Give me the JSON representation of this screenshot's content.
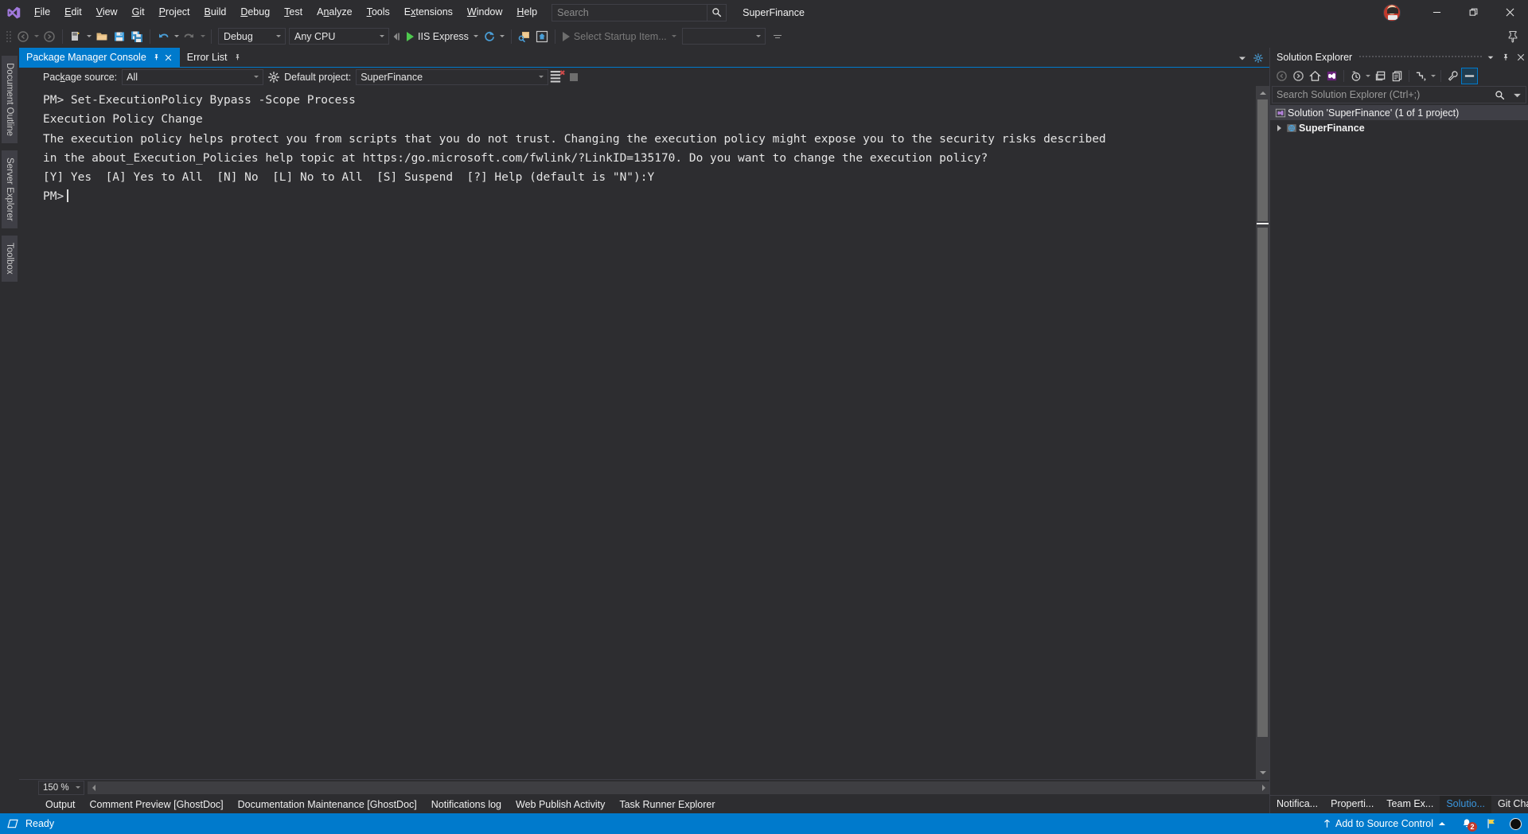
{
  "titlebar": {
    "logo_icon": "visual-studio-logo",
    "menus": [
      {
        "label": "File",
        "accel": "F"
      },
      {
        "label": "Edit",
        "accel": "E"
      },
      {
        "label": "View",
        "accel": "V"
      },
      {
        "label": "Git",
        "accel": "G"
      },
      {
        "label": "Project",
        "accel": "P"
      },
      {
        "label": "Build",
        "accel": "B"
      },
      {
        "label": "Debug",
        "accel": "D"
      },
      {
        "label": "Test",
        "accel": "T"
      },
      {
        "label": "Analyze",
        "accel": "n"
      },
      {
        "label": "Tools",
        "accel": "T"
      },
      {
        "label": "Extensions",
        "accel": "x"
      },
      {
        "label": "Window",
        "accel": "W"
      },
      {
        "label": "Help",
        "accel": "H"
      }
    ],
    "search_placeholder": "Search",
    "search_value": "",
    "solution_name": "SuperFinance",
    "window_buttons": [
      "minimize",
      "restore",
      "close"
    ]
  },
  "toolbar": {
    "nav_back_icon": "navigate-back-icon",
    "nav_forward_icon": "navigate-forward-icon",
    "new_project_icon": "new-project-icon",
    "open_file_icon": "open-file-icon",
    "save_icon": "save-icon",
    "save_all_icon": "save-all-icon",
    "undo_icon": "undo-icon",
    "redo_icon": "redo-icon",
    "configuration": "Debug",
    "platform": "Any CPU",
    "start_label": "IIS Express",
    "refresh_icon": "refresh-icon",
    "hot_reload_icon": "hot-reload-icon",
    "live_preview_icon": "live-preview-icon",
    "startup_item_label": "Select Startup Item...",
    "empty_combo_value": "",
    "overflow_icon": "toolbar-overflow-icon",
    "pin_icon": "pin-window-icon"
  },
  "left_strip": {
    "tabs": [
      "Document Outline",
      "Server Explorer",
      "Toolbox"
    ]
  },
  "doc_tabs": {
    "tabs": [
      {
        "label": "Package Manager Console",
        "active": true,
        "pinnable": true,
        "closable": true
      },
      {
        "label": "Error List",
        "active": false,
        "pinnable": true,
        "closable": false
      }
    ],
    "dropdown_icon": "tab-list-dropdown-icon",
    "settings_icon": "tab-settings-icon"
  },
  "pmc_toolbar": {
    "package_source_label": "Package source:",
    "package_source_accel": "k",
    "package_source_value": "All",
    "settings_icon": "nuget-settings-gear-icon",
    "default_project_label": "Default project:",
    "default_project_value": "SuperFinance",
    "clear_console_icon": "clear-console-icon",
    "stop_icon": "stop-operation-icon"
  },
  "console": {
    "lines": [
      "PM> Set-ExecutionPolicy Bypass -Scope Process",
      "Execution Policy Change",
      "The execution policy helps protect you from scripts that you do not trust. Changing the execution policy might expose you to the security risks described",
      "in the about_Execution_Policies help topic at https:/go.microsoft.com/fwlink/?LinkID=135170. Do you want to change the execution policy?",
      "[Y] Yes  [A] Yes to All  [N] No  [L] No to All  [S] Suspend  [?] Help (default is \"N\"):Y"
    ],
    "prompt": "PM>",
    "zoom_level": "150 %"
  },
  "dock_tabs": {
    "tabs": [
      "Output",
      "Comment Preview [GhostDoc]",
      "Documentation Maintenance [GhostDoc]",
      "Notifications log",
      "Web Publish Activity",
      "Task Runner Explorer"
    ]
  },
  "solution_explorer": {
    "title": "Solution Explorer",
    "header_buttons": [
      "dropdown-icon",
      "pin-icon",
      "close-icon"
    ],
    "toolbar_icons": [
      "back-icon",
      "forward-icon",
      "home-icon",
      "solution-view-icon",
      "pending-changes-icon",
      "collapse-all-icon",
      "show-all-files-icon",
      "sync-with-active-document-icon",
      "properties-icon",
      "preview-selected-items-icon"
    ],
    "search_placeholder": "Search Solution Explorer (Ctrl+;)",
    "search_value": "",
    "tree": [
      {
        "label": "Solution 'SuperFinance' (1 of 1 project)",
        "icon": "solution-icon",
        "level": 0,
        "selected": true,
        "expandable": false
      },
      {
        "label": "SuperFinance",
        "icon": "web-project-icon",
        "level": 1,
        "selected": false,
        "expandable": true
      }
    ],
    "bottom_tabs": [
      {
        "label": "Notifica...",
        "active": false
      },
      {
        "label": "Properti...",
        "active": false
      },
      {
        "label": "Team Ex...",
        "active": false
      },
      {
        "label": "Solutio...",
        "active": true
      },
      {
        "label": "Git Cha...",
        "active": false
      }
    ]
  },
  "statusbar": {
    "state_icon": "ready-state-icon",
    "state": "Ready",
    "source_control_icon": "upload-arrow-icon",
    "source_control_label": "Add to Source Control",
    "notifications_icon": "bell-icon",
    "notifications_count": "2",
    "feedback_icon": "feedback-flag-icon",
    "recording_icon": "record-circle-icon"
  },
  "colors": {
    "accent": "#007acc",
    "chrome": "#2d2d30",
    "panel": "#252526",
    "border": "#3f3f46",
    "text": "#f1f1f1",
    "badge_red": "#c0392b",
    "play_green": "#4ec94e"
  }
}
